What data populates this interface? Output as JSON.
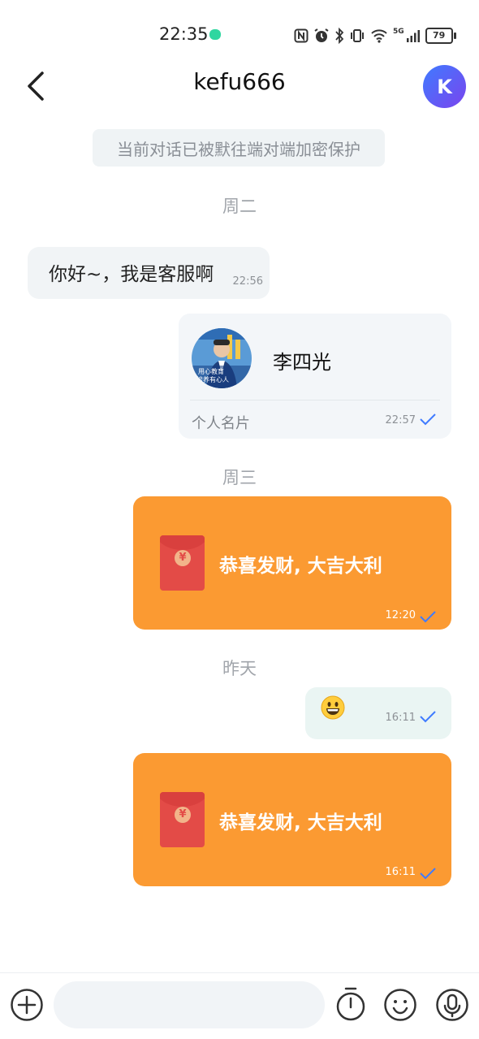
{
  "status_bar": {
    "time": "22:35",
    "network": "5G",
    "battery": "79",
    "icons": [
      "nfc-icon",
      "alarm-icon",
      "bluetooth-icon",
      "vibrate-icon",
      "wifi-icon",
      "signal-icon",
      "battery-icon"
    ]
  },
  "header": {
    "title": "kefu666",
    "avatar_letter": "K"
  },
  "chat": {
    "encryption_notice": "当前对话已被默往端对端加密保护",
    "day_tue": "周二",
    "msg_in": {
      "text": "你好~，我是客服啊",
      "time": "22:56"
    },
    "contact_card": {
      "name": "李四光",
      "label": "个人名片",
      "time": "22:57",
      "photo_caption_1": "用心教育",
      "photo_caption_2": "培养有心人"
    },
    "day_wed": "周三",
    "redpacket_1": {
      "title": "恭喜发财, 大吉大利",
      "time": "12:20"
    },
    "day_yesterday": "昨天",
    "emoji_msg": {
      "emoji": "grinning-face",
      "time": "16:11"
    },
    "redpacket_2": {
      "title": "恭喜发财, 大吉大利",
      "time": "16:11"
    }
  },
  "input": {
    "placeholder": ""
  },
  "colors": {
    "accent": "#3f7bff",
    "redpacket": "#fb9a32",
    "envelope": "#e34b47"
  }
}
